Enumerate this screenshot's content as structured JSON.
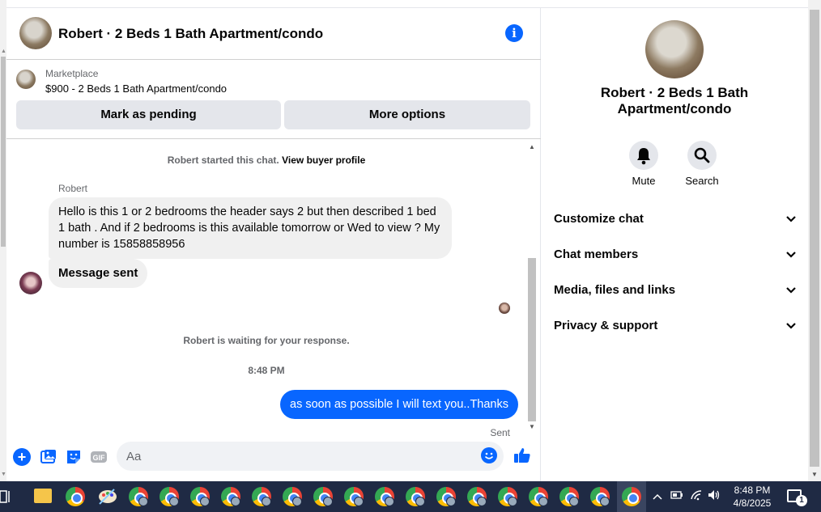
{
  "header": {
    "title": "Robert · 2 Beds 1 Bath Apartment/condo"
  },
  "marketplace": {
    "label": "Marketplace",
    "listing": "$900 - 2 Beds 1 Bath Apartment/condo",
    "mark_pending_label": "Mark as pending",
    "more_options_label": "More options"
  },
  "messages": {
    "started_text": "Robert started this chat.",
    "view_profile_link": "View buyer profile",
    "sender_name": "Robert",
    "incoming_1": "Hello is this 1 or 2 bedrooms the header says 2 but then described 1 bed 1 bath . And if 2 bedrooms is this available tomorrow or Wed to view ? My number is 15858858956",
    "incoming_2": "Message sent",
    "waiting_text": "Robert is waiting for your response.",
    "timestamp": "8:48 PM",
    "outgoing_1": "as soon as possible I will text you..Thanks",
    "sent_status": "Sent"
  },
  "composer": {
    "placeholder": "Aa",
    "value": "",
    "gif_label": "GIF"
  },
  "panel": {
    "title": "Robert · 2 Beds 1 Bath Apartment/condo",
    "mute_label": "Mute",
    "search_label": "Search",
    "sections": [
      {
        "label": "Customize chat"
      },
      {
        "label": "Chat members"
      },
      {
        "label": "Media, files and links"
      },
      {
        "label": "Privacy & support"
      }
    ]
  },
  "taskbar": {
    "time": "8:48 PM",
    "date": "4/8/2025",
    "notification_count": "1"
  },
  "colors": {
    "accent": "#0866ff",
    "bubble_in": "#f0f0f0",
    "button_bg": "#e4e6eb",
    "taskbar_bg": "#1f2a44"
  }
}
